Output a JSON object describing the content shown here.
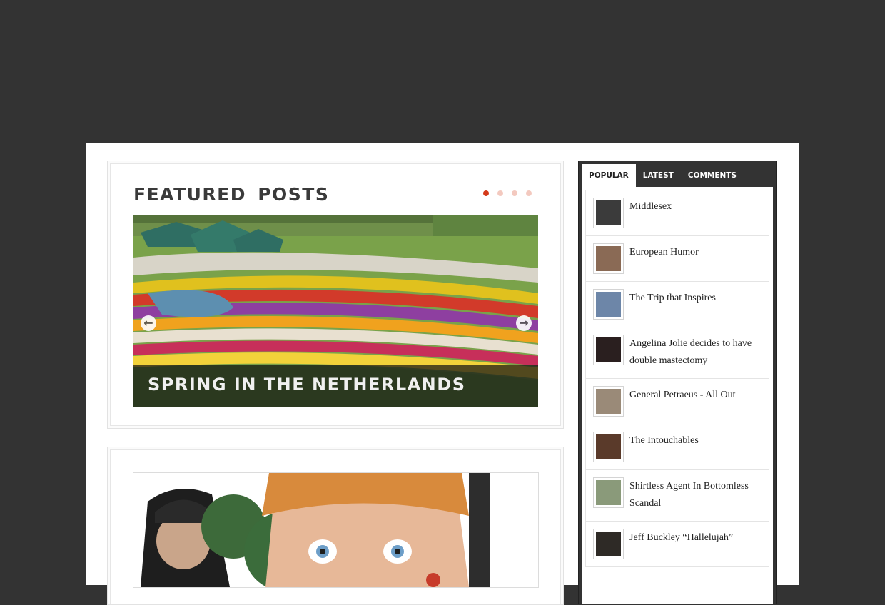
{
  "featured": {
    "title": "Featured Posts",
    "slide_caption": "Spring in the Netherlands",
    "dots": 4,
    "active_dot": 1,
    "prev_icon": "arrow-left-icon",
    "next_icon": "arrow-right-icon"
  },
  "sidebar": {
    "tabs": [
      {
        "label": "Popular",
        "active": true
      },
      {
        "label": "Latest",
        "active": false
      },
      {
        "label": "Comments",
        "active": false
      }
    ],
    "items": [
      {
        "title": "Middlesex",
        "thumb_color": "#3b3b3b"
      },
      {
        "title": "European Humor",
        "thumb_color": "#8a6a55"
      },
      {
        "title": "The Trip that Inspires",
        "thumb_color": "#6d86a8"
      },
      {
        "title": "Angelina Jolie decides to have double mastectomy",
        "thumb_color": "#2a1f1f"
      },
      {
        "title": "General Petraeus - All Out",
        "thumb_color": "#9a8a78"
      },
      {
        "title": "The Intouchables",
        "thumb_color": "#5a3a2a"
      },
      {
        "title": "Shirtless Agent In Bottomless Scandal",
        "thumb_color": "#8a9a7a"
      },
      {
        "title": "Jeff Buckley “Hallelujah”",
        "thumb_color": "#2e2a26"
      }
    ]
  }
}
